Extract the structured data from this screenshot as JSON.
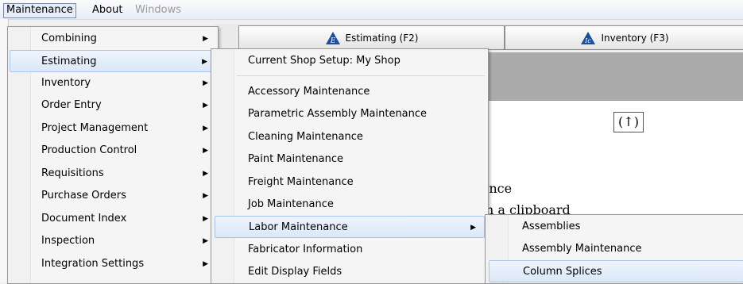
{
  "menubar": {
    "maintenance": "Maintenance",
    "about": "About",
    "windows": "Windows"
  },
  "tabs": {
    "estimating": "Estimating (F2)",
    "inventory": "Inventory (F3)",
    "estimating_icon": "E",
    "inventory_icon": "Ic"
  },
  "background": {
    "up_button": "(↑)",
    "text_line1": "enance",
    "text_line2": "n on a clipboard"
  },
  "main_menu": {
    "items": [
      {
        "label": "Combining"
      },
      {
        "label": "Estimating"
      },
      {
        "label": "Inventory"
      },
      {
        "label": "Order Entry"
      },
      {
        "label": "Project Management"
      },
      {
        "label": "Production Control"
      },
      {
        "label": "Requisitions"
      },
      {
        "label": "Purchase Orders"
      },
      {
        "label": "Document Index"
      },
      {
        "label": "Inspection"
      },
      {
        "label": "Integration Settings"
      }
    ]
  },
  "estimating_menu": {
    "items": [
      {
        "label": "Current Shop Setup: My Shop"
      },
      {
        "label": "Accessory Maintenance"
      },
      {
        "label": "Parametric Assembly Maintenance"
      },
      {
        "label": "Cleaning Maintenance"
      },
      {
        "label": "Paint Maintenance"
      },
      {
        "label": "Freight Maintenance"
      },
      {
        "label": "Job Maintenance"
      },
      {
        "label": "Labor Maintenance"
      },
      {
        "label": "Fabricator Information"
      },
      {
        "label": "Edit Display Fields"
      }
    ]
  },
  "labor_menu": {
    "items": [
      {
        "label": "Assemblies"
      },
      {
        "label": "Assembly Maintenance"
      },
      {
        "label": "Column Splices"
      }
    ]
  },
  "colors": {
    "highlight": "#dbe8f8",
    "tab_icon": "#1a4fa0"
  }
}
